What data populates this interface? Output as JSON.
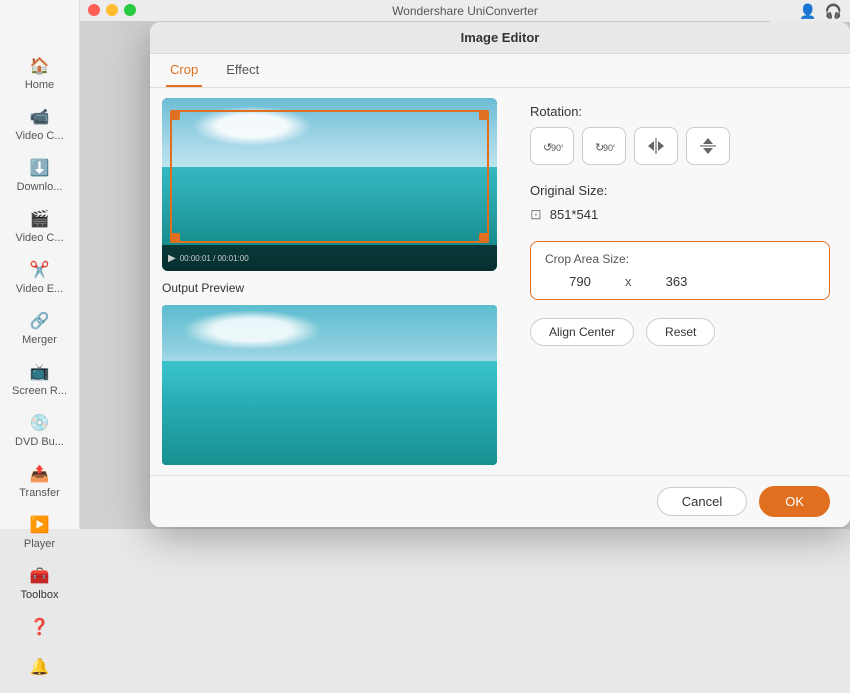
{
  "window": {
    "title": "Wondershare UniConverter",
    "dialog_title": "Image Editor"
  },
  "sidebar": {
    "items": [
      {
        "label": "Home",
        "icon": "🏠",
        "active": false
      },
      {
        "label": "Video C...",
        "icon": "📹",
        "active": false
      },
      {
        "label": "Downlo...",
        "icon": "⬇️",
        "active": false
      },
      {
        "label": "Video C...",
        "icon": "🎬",
        "active": false
      },
      {
        "label": "Video E...",
        "icon": "✂️",
        "active": false
      },
      {
        "label": "Merger",
        "icon": "🔗",
        "active": false
      },
      {
        "label": "Screen R...",
        "icon": "📺",
        "active": false
      },
      {
        "label": "DVD Bu...",
        "icon": "💿",
        "active": false
      },
      {
        "label": "Transfer",
        "icon": "📤",
        "active": false
      },
      {
        "label": "Player",
        "icon": "▶️",
        "active": false
      },
      {
        "label": "Toolbox",
        "icon": "🧰",
        "active": true
      }
    ]
  },
  "tabs": [
    {
      "label": "Crop",
      "active": true
    },
    {
      "label": "Effect",
      "active": false
    }
  ],
  "rotation": {
    "label": "Rotation:",
    "buttons": [
      {
        "icon": "↺",
        "title": "Rotate left 90°",
        "label": "↺90°"
      },
      {
        "icon": "↻",
        "title": "Rotate right 90°",
        "label": "↻90°"
      },
      {
        "icon": "⇄",
        "title": "Flip horizontal",
        "label": "flip-h"
      },
      {
        "icon": "⇅",
        "title": "Flip vertical",
        "label": "flip-v"
      }
    ]
  },
  "original_size": {
    "label": "Original Size:",
    "value": "851*541"
  },
  "crop_area": {
    "label": "Crop Area Size:",
    "width": "790",
    "height": "363",
    "separator": "x"
  },
  "buttons": {
    "align_center": "Align Center",
    "reset": "Reset",
    "cancel": "Cancel",
    "ok": "OK"
  },
  "output_preview_label": "Output Preview"
}
